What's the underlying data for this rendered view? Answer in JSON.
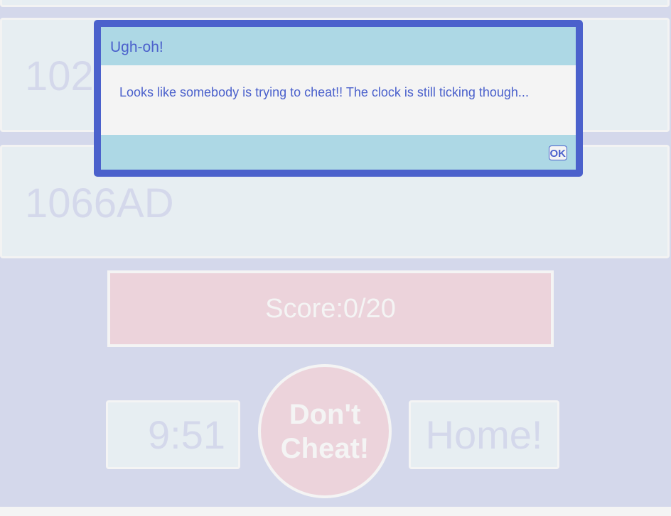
{
  "cards": [
    {
      "text": "1025"
    },
    {
      "text": "1066AD"
    }
  ],
  "score": {
    "label": "Score:0/20"
  },
  "timer": {
    "value": "9:51"
  },
  "cheat_button": {
    "line1": "Don't",
    "line2": "Cheat!"
  },
  "home_button": {
    "label": "Home!"
  },
  "dialog": {
    "title": "Ugh-oh!",
    "message": "Looks like somebody is trying to cheat!! The clock is still ticking though...",
    "ok_label": "OK"
  },
  "colors": {
    "background": "#d4d8eb",
    "dialog_border": "#4b61cc",
    "dialog_header": "#add8e5",
    "score_bg": "#ecd3db"
  }
}
